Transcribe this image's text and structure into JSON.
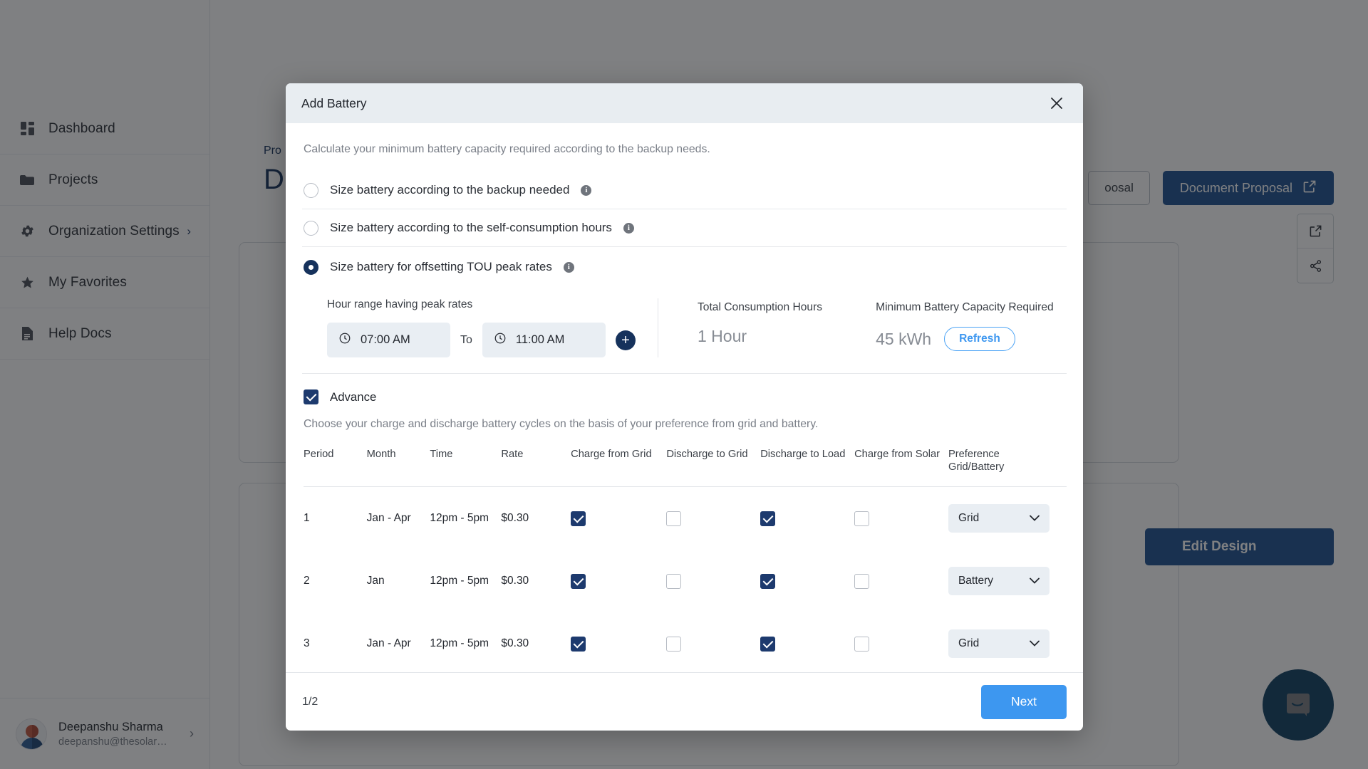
{
  "sidebar": {
    "items": [
      {
        "label": "Dashboard",
        "icon": "grid-icon",
        "has_chevron": false
      },
      {
        "label": "Projects",
        "icon": "folder-icon",
        "has_chevron": false
      },
      {
        "label": "Organization Settings",
        "icon": "gear-icon",
        "has_chevron": true
      },
      {
        "label": "My Favorites",
        "icon": "star-icon",
        "has_chevron": false
      },
      {
        "label": "Help Docs",
        "icon": "document-icon",
        "has_chevron": false
      }
    ],
    "user": {
      "name": "Deepanshu Sharma",
      "email": "deepanshu@thesolar…"
    }
  },
  "background": {
    "breadcrumb": "Pro",
    "page_title": "D",
    "outline_button_label": "oosal",
    "document_proposal_label": "Document Proposal",
    "edit_design_label": "Edit Design"
  },
  "modal": {
    "title": "Add Battery",
    "subtitle": "Calculate your minimum battery capacity required according to the backup needs.",
    "options": [
      {
        "label": "Size battery according to the backup needed",
        "selected": false
      },
      {
        "label": "Size battery according to the self-consumption hours",
        "selected": false
      },
      {
        "label": "Size battery for offsetting TOU peak rates",
        "selected": true
      }
    ],
    "tou": {
      "range_label": "Hour range having peak rates",
      "from_time": "07:00 AM",
      "to_separator": "To",
      "to_time": "11:00 AM",
      "add_button": "+",
      "total_hours_label": "Total Consumption Hours",
      "total_hours_value": "1 Hour",
      "capacity_label": "Minimum Battery Capacity Required",
      "capacity_value": "45 kWh",
      "refresh_label": "Refresh"
    },
    "advance": {
      "checkbox_label": "Advance",
      "checked": true,
      "description": "Choose your charge and discharge battery cycles on the basis of your preference from grid and battery."
    },
    "table": {
      "headers": [
        "Period",
        "Month",
        "Time",
        "Rate",
        "Charge from Grid",
        "Discharge to Grid",
        "Discharge to Load",
        "Charge from Solar",
        "Preference Grid/Battery"
      ],
      "preference_header_line1": "Preference",
      "preference_header_line2": "Grid/Battery",
      "rows": [
        {
          "period": "1",
          "month": "Jan - Apr",
          "time": "12pm - 5pm",
          "rate": "$0.30",
          "charge_from_grid": true,
          "discharge_to_grid": false,
          "discharge_to_load": true,
          "charge_from_solar": false,
          "preference": "Grid"
        },
        {
          "period": "2",
          "month": "Jan",
          "time": "12pm - 5pm",
          "rate": "$0.30",
          "charge_from_grid": true,
          "discharge_to_grid": false,
          "discharge_to_load": true,
          "charge_from_solar": false,
          "preference": "Battery"
        },
        {
          "period": "3",
          "month": "Jan - Apr",
          "time": "12pm - 5pm",
          "rate": "$0.30",
          "charge_from_grid": true,
          "discharge_to_grid": false,
          "discharge_to_load": true,
          "charge_from_solar": false,
          "preference": "Grid"
        }
      ]
    },
    "footer": {
      "page_indicator": "1/2",
      "next_label": "Next"
    }
  },
  "colors": {
    "modal_header_bg": "#e8edf1",
    "accent_navy": "#16325c",
    "accent_blue": "#3d97f0",
    "checkbox_checked": "#1d3a6e",
    "primary_dark_button": "#1d5190",
    "chat_bubble": "#0e3e61"
  }
}
